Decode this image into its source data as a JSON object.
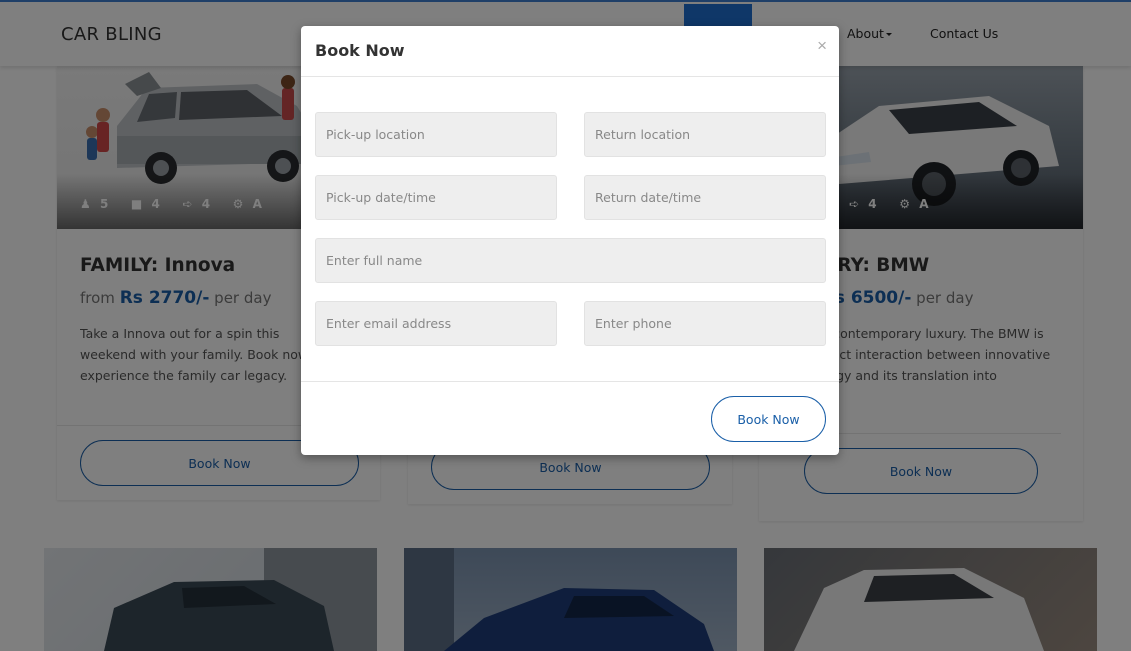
{
  "navbar": {
    "brand": "CAR BLING",
    "about_label": "About",
    "contact_label": "Contact Us"
  },
  "cards": [
    {
      "category_title": "FAMILY: Innova",
      "price_prefix": "from ",
      "price": "Rs 2770/-",
      "price_suffix": " per day",
      "description": "Take a Innova out for a spin this weekend with your family. Book now to experience the family car legacy.",
      "features": {
        "seats": "5",
        "bags": "4",
        "doors": "4",
        "transmission": "A"
      },
      "button_label": "Book Now"
    },
    {
      "button_label": "Book Now"
    },
    {
      "category_title": "LUXURY: BMW",
      "price_prefix": "from ",
      "price": "Rs 6500/-",
      "price_suffix": " per day",
      "description": "Take on contemporary luxury. The BMW is the perfect interaction between innovative technology and its translation into",
      "features": {
        "doors": "4",
        "transmission": "A"
      },
      "button_label": "Book Now"
    }
  ],
  "modal": {
    "title": "Book Now",
    "close_glyph": "×",
    "fields": {
      "pickup_location": "Pick-up location",
      "return_location": "Return location",
      "pickup_datetime": "Pick-up date/time",
      "return_datetime": "Return date/time",
      "full_name": "Enter full name",
      "email": "Enter email address",
      "phone": "Enter phone"
    },
    "submit_label": "Book Now"
  },
  "colors": {
    "accent": "#1a5fa8",
    "nav_active": "#1f6fd0",
    "overlay": "rgba(0,0,0,0.5)"
  },
  "icons": {
    "seats": "user-icon",
    "bags": "briefcase-icon",
    "doors": "door-exit-icon",
    "transmission": "gear-icon",
    "close": "close-icon"
  }
}
